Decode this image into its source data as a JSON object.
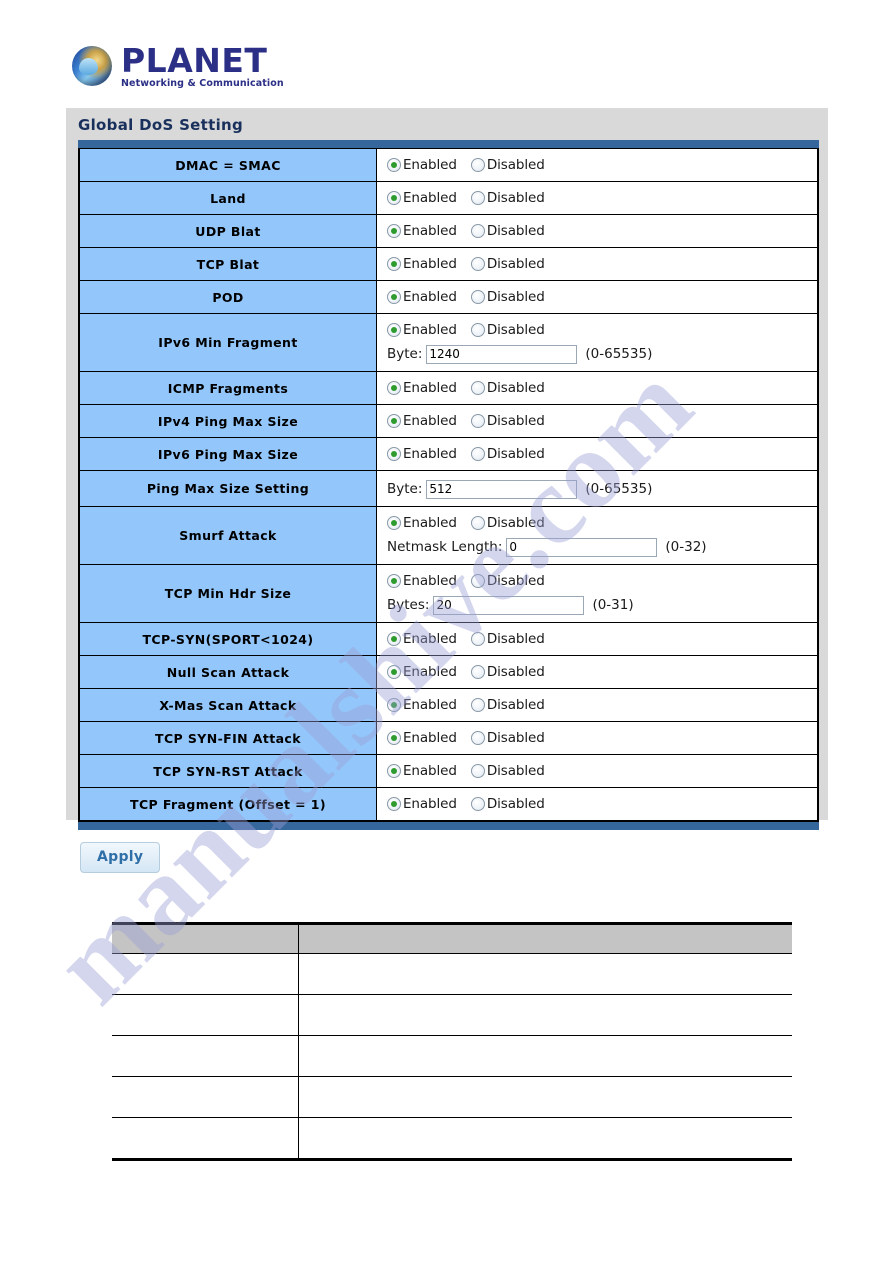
{
  "logo": {
    "brand": "PLANET",
    "tagline": "Networking & Communication",
    "icon": "globe-icon"
  },
  "panel": {
    "title": "Global DoS Setting",
    "apply_label": "Apply"
  },
  "labels": {
    "enabled": "Enabled",
    "disabled": "Disabled",
    "byte": "Byte:",
    "bytes": "Bytes:",
    "netmask_length": "Netmask Length:",
    "range_65535": "(0-65535)",
    "range_32": "(0-32)",
    "range_31": "(0-31)"
  },
  "rows": [
    {
      "name": "DMAC = SMAC",
      "selected": "enabled"
    },
    {
      "name": "Land",
      "selected": "enabled"
    },
    {
      "name": "UDP Blat",
      "selected": "enabled"
    },
    {
      "name": "TCP Blat",
      "selected": "enabled"
    },
    {
      "name": "POD",
      "selected": "enabled"
    },
    {
      "name": "IPv6 Min Fragment",
      "selected": "enabled",
      "field_label": "Byte:",
      "field_value": "1240",
      "field_range": "(0-65535)"
    },
    {
      "name": "ICMP Fragments",
      "selected": "enabled"
    },
    {
      "name": "IPv4 Ping Max Size",
      "selected": "enabled"
    },
    {
      "name": "IPv6 Ping Max Size",
      "selected": "enabled"
    },
    {
      "name": "Ping Max Size Setting",
      "selected": null,
      "field_label": "Byte:",
      "field_value": "512",
      "field_range": "(0-65535)"
    },
    {
      "name": "Smurf Attack",
      "selected": "enabled",
      "field_label": "Netmask Length:",
      "field_value": "0",
      "field_range": "(0-32)"
    },
    {
      "name": "TCP Min Hdr Size",
      "selected": "enabled",
      "field_label": "Bytes:",
      "field_value": "20",
      "field_range": "(0-31)"
    },
    {
      "name": "TCP-SYN(SPORT<1024)",
      "selected": "enabled"
    },
    {
      "name": "Null Scan Attack",
      "selected": "enabled"
    },
    {
      "name": "X-Mas Scan Attack",
      "selected": "enabled"
    },
    {
      "name": "TCP SYN-FIN Attack",
      "selected": "enabled"
    },
    {
      "name": "TCP SYN-RST Attack",
      "selected": "enabled"
    },
    {
      "name": "TCP Fragment (Offset = 1)",
      "selected": "enabled"
    }
  ],
  "param_table": {
    "header": [
      "",
      ""
    ],
    "rows": [
      [
        "",
        ""
      ],
      [
        "",
        ""
      ],
      [
        "",
        ""
      ],
      [
        "",
        ""
      ],
      [
        "",
        ""
      ]
    ]
  },
  "watermark": {
    "text": "manualshive.com"
  },
  "colors": {
    "label_blue": "#93c7fb",
    "bar_blue": "#35679c",
    "panel_gray": "#d9d9d9",
    "radio_green": "#2e9b2e",
    "title_navy": "#19305c",
    "brand_navy": "#2b2f86"
  }
}
